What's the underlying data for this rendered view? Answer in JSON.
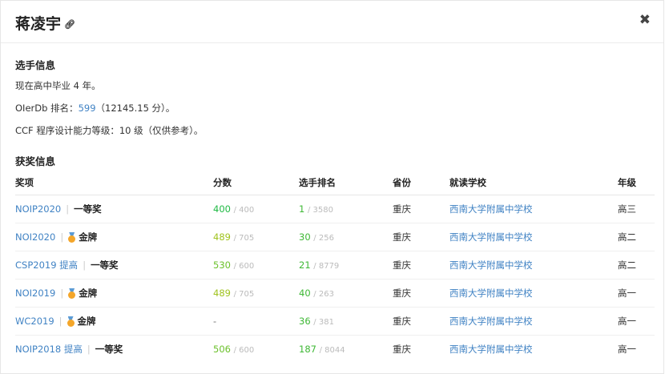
{
  "header": {
    "title": "蒋凌宇",
    "link_icon": "link-icon",
    "close_icon": "close-icon"
  },
  "info": {
    "heading": "选手信息",
    "graduation": "现在高中毕业 4 年。",
    "rank_prefix": "OIerDb 排名：",
    "rank": "599",
    "rank_suffix": "（12145.15 分）。",
    "ccf": "CCF 程序设计能力等级：10 级（仅供参考）。"
  },
  "awards": {
    "heading": "获奖信息",
    "columns": [
      "奖项",
      "分数",
      "选手排名",
      "省份",
      "就读学校",
      "年级"
    ],
    "colors": {
      "link": "#4183c4",
      "score_full": "#21ba45",
      "score_mid": "#a0c31f",
      "score_high": "#6cc12c",
      "rank": "#3fb836"
    },
    "rows": [
      {
        "contest": "NOIP2020",
        "award": "一等奖",
        "medal": false,
        "score": "400",
        "score_total": "/ 400",
        "score_color": "#21ba45",
        "rank": "1",
        "rank_total": "/ 3580",
        "province": "重庆",
        "school": "西南大学附属中学校",
        "grade": "高三"
      },
      {
        "contest": "NOI2020",
        "award": "金牌",
        "medal": true,
        "score": "489",
        "score_total": "/ 705",
        "score_color": "#a0c31f",
        "rank": "30",
        "rank_total": "/ 256",
        "province": "重庆",
        "school": "西南大学附属中学校",
        "grade": "高二"
      },
      {
        "contest": "CSP2019 提高",
        "award": "一等奖",
        "medal": false,
        "score": "530",
        "score_total": "/ 600",
        "score_color": "#6cc12c",
        "rank": "21",
        "rank_total": "/ 8779",
        "province": "重庆",
        "school": "西南大学附属中学校",
        "grade": "高二"
      },
      {
        "contest": "NOI2019",
        "award": "金牌",
        "medal": true,
        "score": "489",
        "score_total": "/ 705",
        "score_color": "#a0c31f",
        "rank": "40",
        "rank_total": "/ 263",
        "province": "重庆",
        "school": "西南大学附属中学校",
        "grade": "高一"
      },
      {
        "contest": "WC2019",
        "award": "金牌",
        "medal": true,
        "score": "-",
        "score_total": "",
        "score_color": "#777777",
        "rank": "36",
        "rank_total": "/ 381",
        "province": "重庆",
        "school": "西南大学附属中学校",
        "grade": "高一"
      },
      {
        "contest": "NOIP2018 提高",
        "award": "一等奖",
        "medal": false,
        "score": "506",
        "score_total": "/ 600",
        "score_color": "#6cc12c",
        "rank": "187",
        "rank_total": "/ 8044",
        "province": "重庆",
        "school": "西南大学附属中学校",
        "grade": "高一"
      }
    ]
  }
}
